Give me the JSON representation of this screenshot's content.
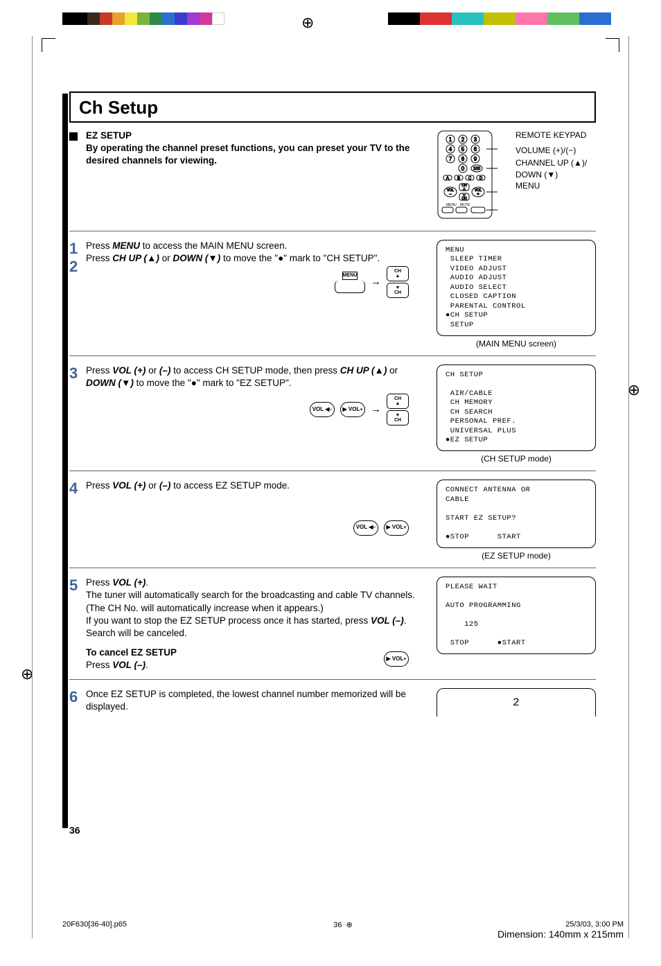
{
  "colorbars": {
    "left": [
      "#000",
      "#000",
      "#3a2a1d",
      "#c53a28",
      "#e8a12e",
      "#f2e83a",
      "#7bb23a",
      "#2a8a4a",
      "#2a6fd0",
      "#3a3ad0",
      "#a03ad0",
      "#d03a9a",
      "#fff",
      "#fff"
    ],
    "right": [
      "#000",
      "#d33",
      "#2ac0c0",
      "#c0c000",
      "#f7a",
      "#60c060",
      "#2a6fd0",
      "#000"
    ]
  },
  "title": "Ch Setup",
  "ez_head": {
    "title": "EZ SETUP",
    "text": "By operating the channel preset functions, you can preset your TV to the desired channels for viewing."
  },
  "remote_labels": {
    "keypad": "REMOTE KEYPAD",
    "volume": "VOLUME (+)/(−)",
    "channel": "CHANNEL UP (▲)/ DOWN (▼)",
    "menu": "MENU"
  },
  "step1": {
    "line1_pre": "Press ",
    "line1_btn": "MENU",
    "line1_post": " to access the MAIN MENU screen.",
    "line2_pre": "Press ",
    "line2_btn1": "CH UP (▲)",
    "line2_mid": " or ",
    "line2_btn2": "DOWN (▼)",
    "line2_post": " to move the \"●\" mark to \"CH SETUP\".",
    "menu_label": "MENU",
    "screen": "MENU\n SLEEP TIMER\n VIDEO ADJUST\n AUDIO ADJUST\n AUDIO SELECT\n CLOSED CAPTION\n PARENTAL CONTROL\n●CH SETUP\n SETUP",
    "caption": "(MAIN MENU screen)"
  },
  "step3": {
    "line1_pre": "Press ",
    "vol_plus": "VOL (+)",
    "or": " or ",
    "vol_minus": "(–)",
    "line1_post": " to access CH SETUP mode, then press ",
    "btn1": "CH UP (▲)",
    "mid": " or ",
    "btn2": "DOWN (▼)",
    "line2_post": " to move the \"●\" mark to \"EZ SETUP\".",
    "screen": "CH SETUP\n\n AIR/CABLE\n CH MEMORY\n CH SEARCH\n PERSONAL PREF.\n UNIVERSAL PLUS\n●EZ SETUP",
    "caption": "(CH SETUP mode)"
  },
  "step4": {
    "pre": "Press ",
    "vol_plus": "VOL (+)",
    "or": " or ",
    "vol_minus": "(–)",
    "post": " to access EZ SETUP mode.",
    "screen": "CONNECT ANTENNA OR\nCABLE\n\nSTART EZ SETUP?\n\n●STOP      START",
    "caption": "(EZ SETUP mode)"
  },
  "step5": {
    "l1_pre": "Press ",
    "l1_btn": "VOL (+)",
    "l1_post": ".",
    "l2": "The tuner will automatically search for the broadcasting and cable TV channels. (The CH No. will automatically increase when it appears.)",
    "l3_pre": "If you want to stop the EZ SETUP process once it has started, press ",
    "l3_btn": "VOL (–)",
    "l3_post": ". Search will be canceled.",
    "cancel_title": "To cancel EZ SETUP",
    "cancel_pre": "Press ",
    "cancel_btn": "VOL (–)",
    "cancel_post": ".",
    "screen": "PLEASE WAIT\n\nAUTO PROGRAMMING\n\n    125\n\n STOP      ●START"
  },
  "step6": {
    "text": "Once EZ SETUP is completed, the lowest channel number memorized will be displayed.",
    "screen": "2"
  },
  "buttons": {
    "ch_up": "CH\n▲",
    "ch_down": "▼\nCH",
    "vol_minus": "VOL ◀\n–",
    "vol_plus": "▶ VOL\n+",
    "arrow": "→"
  },
  "page_number": "36",
  "footer": {
    "file": "20F630[36-40].p65",
    "page": "36",
    "date": "25/3/03, 3:00 PM",
    "dim": "Dimension: 140mm x 215mm"
  }
}
